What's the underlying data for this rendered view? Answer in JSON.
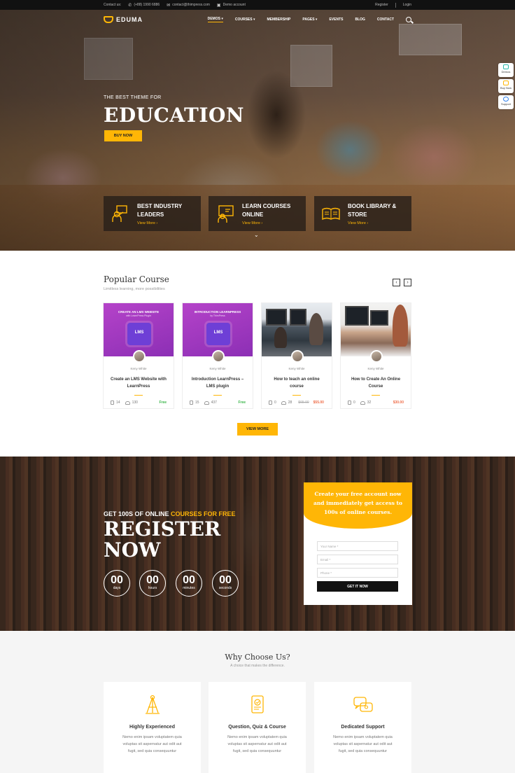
{
  "topbar": {
    "contact_label": "Contact us:",
    "phone": "(+88) 1990 6886",
    "email": "contact@thimpress.com",
    "demo": "Demo account",
    "register": "Register",
    "login": "Login"
  },
  "nav": {
    "logo": "EDUMA",
    "items": [
      "DEMOS",
      "COURSES",
      "MEMBERSHIP",
      "PAGES",
      "EVENTS",
      "BLOG",
      "CONTACT"
    ]
  },
  "hero": {
    "subtitle": "THE BEST THEME FOR",
    "title": "EDUCATION",
    "button": "BUY NOW",
    "features": [
      {
        "title_1": "BEST INDUSTRY",
        "title_2": "LEADERS",
        "more": "View More"
      },
      {
        "title_1": "LEARN COURSES",
        "title_2": "ONLINE",
        "more": "View More"
      },
      {
        "title_1": "BOOK LIBRARY &",
        "title_2": "STORE",
        "more": "View More"
      }
    ]
  },
  "side_widgets": [
    "Demos",
    "Buy Now",
    "Support"
  ],
  "courses": {
    "title": "Popular Course",
    "subtitle": "Limitless learning, more possibilities",
    "prev": "‹",
    "next": "›",
    "items": [
      {
        "thumb_title": "CREATE AN LMS WEBSITE",
        "thumb_sub": "with LearnPress Plugin",
        "teacher": "Keny White",
        "title_1": "Create an LMS Website with",
        "title_2": "LearnPress",
        "lessons": "14",
        "students": "130",
        "old_price": "",
        "price": "Free"
      },
      {
        "thumb_title": "INTRODUCTION LEARNPRESS",
        "thumb_sub": "by ThimPress",
        "teacher": "Keny White",
        "title_1": "Introduction LearnPress –",
        "title_2": "LMS plugin",
        "lessons": "15",
        "students": "437",
        "old_price": "",
        "price": "Free"
      },
      {
        "thumb_title": "",
        "thumb_sub": "",
        "teacher": "Keny White",
        "title_1": "How to teach an online",
        "title_2": "course",
        "lessons": "0",
        "students": "28",
        "old_price": "$65.00",
        "price": "$55.00"
      },
      {
        "thumb_title": "",
        "thumb_sub": "",
        "teacher": "Keny White",
        "title_1": "How to Create An Online",
        "title_2": "Course",
        "lessons": "0",
        "students": "32",
        "old_price": "",
        "price": "$30.00"
      }
    ],
    "lms_label": "LMS",
    "view_more": "VIEW MORE"
  },
  "register": {
    "sub_prefix": "GET 100S OF ONLINE ",
    "sub_highlight": "COURSES FOR FREE",
    "title_1": "REGISTER",
    "title_2": "NOW",
    "countdown": [
      {
        "value": "00",
        "unit": "days"
      },
      {
        "value": "00",
        "unit": "hours"
      },
      {
        "value": "00",
        "unit": "minutes"
      },
      {
        "value": "00",
        "unit": "seconds"
      }
    ],
    "box_line_1": "Create your free account now",
    "box_line_2": "and immediately get access to",
    "box_line_3": "100s of online courses.",
    "placeholders": {
      "name": "Your Name *",
      "email": "Email *",
      "phone": "Phone *"
    },
    "submit": "GET IT NOW"
  },
  "why": {
    "title": "Why Choose Us?",
    "subtitle": "A choice that makes the difference.",
    "cards": [
      {
        "title": "Highly Experienced",
        "d1": "Nemo enim ipsam voluptatem quia",
        "d2": "voluptas sit aspernatur aut odit aut",
        "d3": "fugit, sed quia consequuntur"
      },
      {
        "title": "Question, Quiz & Course",
        "d1": "Nemo enim ipsam voluptatem quia",
        "d2": "voluptas sit aspernatur aut odit aut",
        "d3": "fugit, sed quia consequuntur"
      },
      {
        "title": "Dedicated Support",
        "d1": "Nemo enim ipsam voluptatem quia",
        "d2": "voluptas sit aspernatur aut odit aut",
        "d3": "fugit, sed quia consequuntur"
      }
    ]
  },
  "colors": {
    "accent": "#ffb606",
    "free": "#3bb54a",
    "sale": "#ef6e4a",
    "dark": "#111111"
  }
}
